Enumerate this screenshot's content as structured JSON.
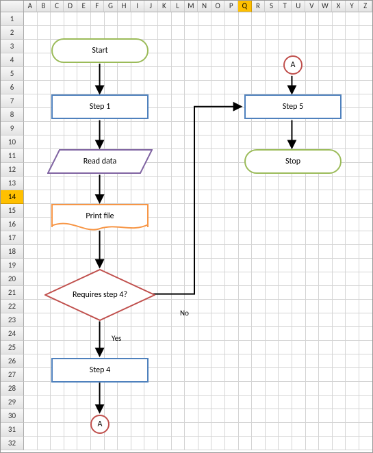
{
  "columns": [
    "A",
    "B",
    "C",
    "D",
    "E",
    "F",
    "G",
    "H",
    "I",
    "J",
    "K",
    "L",
    "M",
    "N",
    "O",
    "P",
    "Q",
    "R",
    "S",
    "T",
    "U",
    "V",
    "W",
    "X",
    "Y",
    "Z"
  ],
  "rowCount": 32,
  "selectedColumn": "Q",
  "selectedRow": 14,
  "shapes": {
    "start": "Start",
    "step1": "Step 1",
    "read": "Read data",
    "print": "Print file",
    "decision": "Requires step 4?",
    "step4": "Step 4",
    "connA1": "A",
    "connA2": "A",
    "step5": "Step 5",
    "stop": "Stop"
  },
  "labels": {
    "yes": "Yes",
    "no": "No"
  },
  "chart_data": {
    "type": "flowchart",
    "nodes": [
      {
        "id": "start",
        "type": "terminator",
        "label": "Start"
      },
      {
        "id": "step1",
        "type": "process",
        "label": "Step 1"
      },
      {
        "id": "read",
        "type": "data",
        "label": "Read data"
      },
      {
        "id": "print",
        "type": "document",
        "label": "Print file"
      },
      {
        "id": "dec",
        "type": "decision",
        "label": "Requires step 4?"
      },
      {
        "id": "step4",
        "type": "process",
        "label": "Step 4"
      },
      {
        "id": "a1",
        "type": "connector",
        "label": "A"
      },
      {
        "id": "a2",
        "type": "connector",
        "label": "A"
      },
      {
        "id": "step5",
        "type": "process",
        "label": "Step 5"
      },
      {
        "id": "stop",
        "type": "terminator",
        "label": "Stop"
      }
    ],
    "edges": [
      {
        "from": "start",
        "to": "step1"
      },
      {
        "from": "step1",
        "to": "read"
      },
      {
        "from": "read",
        "to": "print"
      },
      {
        "from": "print",
        "to": "dec"
      },
      {
        "from": "dec",
        "to": "step4",
        "label": "Yes"
      },
      {
        "from": "dec",
        "to": "step5",
        "label": "No"
      },
      {
        "from": "step4",
        "to": "a1"
      },
      {
        "from": "a2",
        "to": "step5"
      },
      {
        "from": "step5",
        "to": "stop"
      }
    ]
  }
}
